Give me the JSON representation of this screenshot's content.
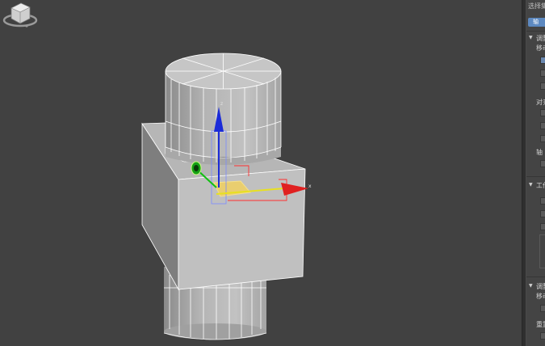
{
  "panel": {
    "header": "选择集",
    "tab": "轴",
    "rollouts": [
      {
        "title": "调整",
        "label": "移动"
      },
      {
        "title": "工作"
      },
      {
        "title": "调整",
        "label": "移动"
      }
    ],
    "labels": {
      "align": "对齐",
      "axis": "轴",
      "reset": "重置"
    }
  },
  "gizmo": {
    "x_label": "x",
    "z_label": "z"
  },
  "colors": {
    "background": "#414141",
    "mesh": "#bdbdbd",
    "wire": "#ffffff",
    "x_axis": "#e02020",
    "y_axis": "#10c010",
    "z_axis": "#1b2bd8",
    "plane": "#f0d060",
    "selection": "#5d89c0"
  }
}
